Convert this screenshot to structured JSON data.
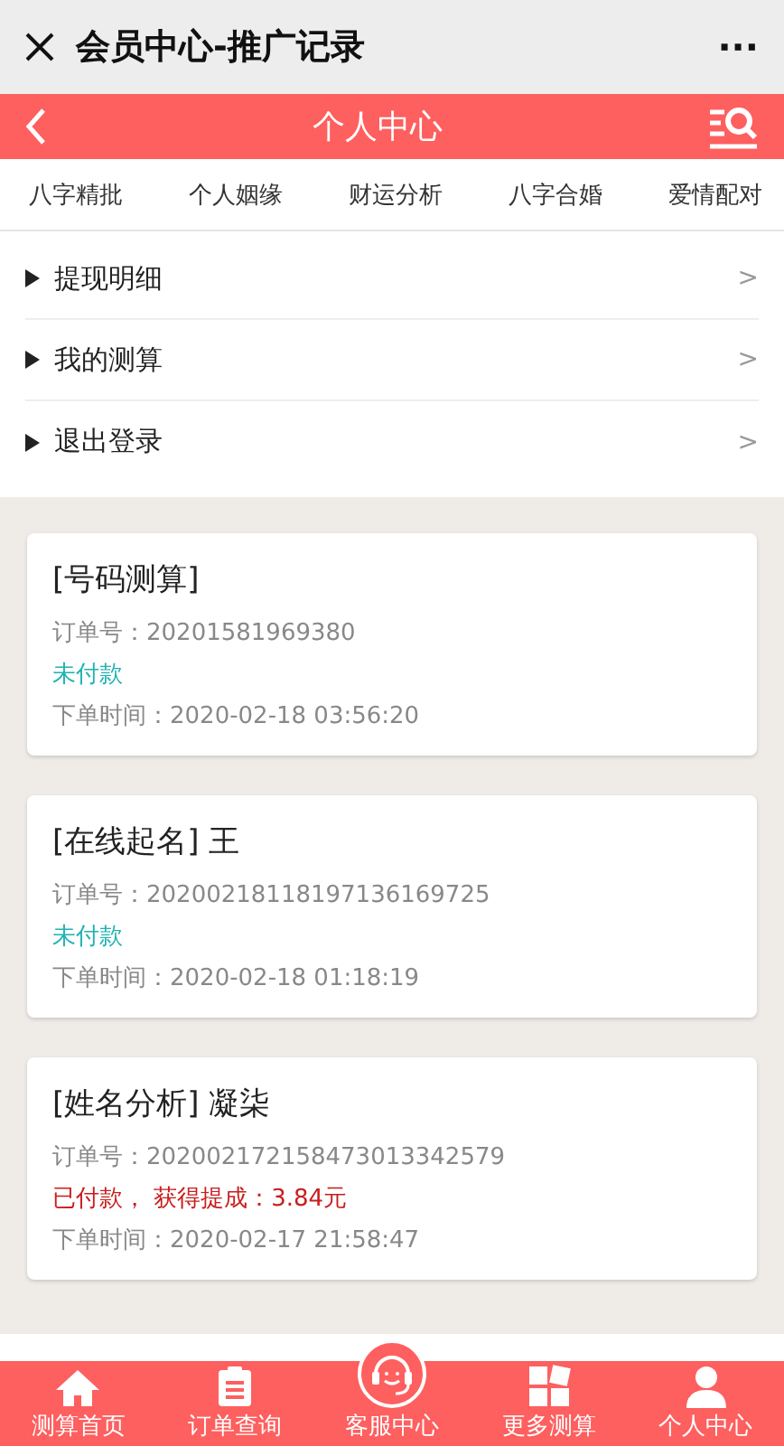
{
  "window": {
    "title": "会员中心-推广记录",
    "more": "···"
  },
  "header": {
    "title": "个人中心"
  },
  "nav": [
    "八字精批",
    "个人姻缘",
    "财运分析",
    "八字合婚",
    "爱情配对"
  ],
  "menu": [
    {
      "label": "提现明细",
      "arrow": ">"
    },
    {
      "label": "我的测算",
      "arrow": ">"
    },
    {
      "label": "退出登录",
      "arrow": ">"
    }
  ],
  "orders": [
    {
      "title": "[号码测算]",
      "order_no": "订单号：20201581969380",
      "status": "未付款",
      "kind": "unpaid",
      "time": "下单时间：2020-02-18 03:56:20"
    },
    {
      "title": "[在线起名] 王",
      "order_no": "订单号：20200218118197136169725",
      "status": "未付款",
      "kind": "unpaid",
      "time": "下单时间：2020-02-18 01:18:19"
    },
    {
      "title": "[姓名分析] 凝柒",
      "order_no": "订单号：20200217215847301334257​9",
      "status": "已付款， 获得提成：3.84元",
      "kind": "paid",
      "time": "下单时间：2020-02-17 21:58:47"
    }
  ],
  "tabbar": [
    {
      "label": "测算首页"
    },
    {
      "label": "订单查询"
    },
    {
      "label": "客服中心"
    },
    {
      "label": "更多测算"
    },
    {
      "label": "个人中心"
    }
  ]
}
